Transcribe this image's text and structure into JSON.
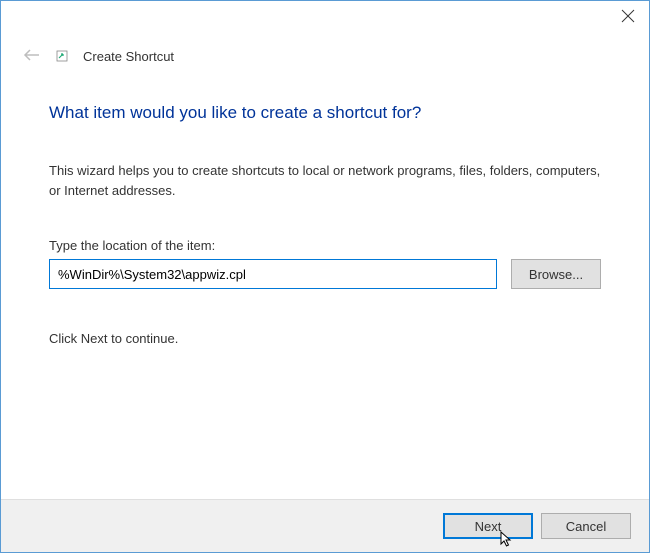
{
  "header": {
    "title": "Create Shortcut"
  },
  "main": {
    "heading": "What item would you like to create a shortcut for?",
    "description": "This wizard helps you to create shortcuts to local or network programs, files, folders, computers, or Internet addresses.",
    "location_label": "Type the location of the item:",
    "location_value": "%WinDir%\\System32\\appwiz.cpl",
    "browse_label": "Browse...",
    "continue_text": "Click Next to continue."
  },
  "footer": {
    "next_label": "Next",
    "cancel_label": "Cancel"
  }
}
